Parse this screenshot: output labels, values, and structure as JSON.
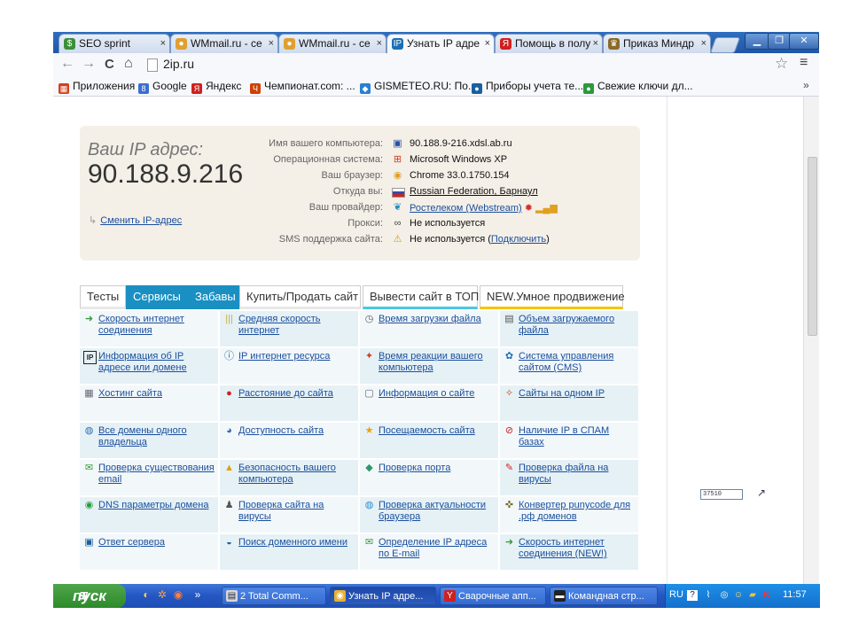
{
  "browser": {
    "tabs": [
      {
        "label": "SEO sprint",
        "icon": "dollar-icon",
        "color": "#3a8f3a"
      },
      {
        "label": "WMmail.ru - се",
        "icon": "coin-icon",
        "color": "#e0a030"
      },
      {
        "label": "WMmail.ru - се",
        "icon": "coin-icon",
        "color": "#e0a030"
      },
      {
        "label": "Узнать IP адре",
        "icon": "ip-icon",
        "color": "#1a6fb5"
      },
      {
        "label": "Помощь в полу",
        "icon": "yandex-icon",
        "color": "#d02020"
      },
      {
        "label": "Приказ Миндр",
        "icon": "emblem-icon",
        "color": "#8a6a2a"
      }
    ],
    "close_glyph": "×",
    "window_controls": {
      "minimize": "▁",
      "maximize": "❐",
      "close": "✕"
    },
    "nav": {
      "back": "←",
      "forward": "→",
      "reload": "C",
      "home": "⌂"
    },
    "url": "2ip.ru",
    "star": "☆",
    "menu": "≡",
    "bookmarks": [
      {
        "label": "Приложения",
        "color": "#d04020"
      },
      {
        "label": "Google",
        "color": "#3a6fd0"
      },
      {
        "label": "Яндекс",
        "color": "#d02020"
      },
      {
        "label": "Чемпионат.com: ...",
        "color": "#d04000"
      },
      {
        "label": "GISMETEO.RU: По...",
        "color": "#2a7fd0"
      },
      {
        "label": "Приборы учета те...",
        "color": "#1a5fa0"
      },
      {
        "label": "Свежие ключи дл...",
        "color": "#2a9a3a"
      }
    ],
    "bookmarks_more": "»"
  },
  "ip": {
    "label": "Ваш IP адрес:",
    "value": "90.188.9.216",
    "change_link": "Сменить IP-адрес",
    "rows": [
      {
        "key": "Имя вашего компьютера:",
        "value": "90.188.9-216.xdsl.ab.ru",
        "icon": "computer-icon",
        "link": false
      },
      {
        "key": "Операционная система:",
        "value": "Microsoft Windows XP",
        "icon": "windows-icon",
        "link": false
      },
      {
        "key": "Ваш браузер:",
        "value": "Chrome 33.0.1750.154",
        "icon": "chrome-icon",
        "link": false
      },
      {
        "key": "Откуда вы:",
        "value": "Russian Federation, Барнаул",
        "icon": "flag-icon",
        "link": true
      },
      {
        "key": "Ваш провайдер:",
        "value": "Ростелеком (Webstream)",
        "icon": "provider-icon",
        "link": true
      },
      {
        "key": "Прокси:",
        "value": "Не используется",
        "icon": "glasses-icon",
        "link": false
      },
      {
        "key": "SMS поддержка сайта:",
        "value": "Не используется (",
        "suffix_link": "Подключить",
        "suffix_end": ")",
        "icon": "warning-icon",
        "link": false
      }
    ]
  },
  "menu_tabs": [
    "Тесты",
    "Сервисы",
    "Забавы",
    "Купить/Продать сайт",
    "Вывести сайт в ТОП",
    "NEW.Умное продвижение"
  ],
  "services": [
    [
      "Скорость интернет соединения",
      "Средняя скорость интернет",
      "Время загрузки файла",
      "Объем загружаемого файла"
    ],
    [
      "Информация об IP адресе или домене",
      "IP интернет ресурса",
      "Время реакции вашего компьютера",
      "Система управления сайтом (CMS)"
    ],
    [
      "Хостинг сайта",
      "Расстояние до сайта",
      "Информация о сайте",
      "Сайты на одном IP"
    ],
    [
      "Все домены одного владельца",
      "Доступность сайта",
      "Посещаемость сайта",
      "Наличие IP в СПАМ базах"
    ],
    [
      "Проверка существования email",
      "Безопасность вашего компьютера",
      "Проверка порта",
      "Проверка файла на вирусы"
    ],
    [
      "DNS параметры домена",
      "Проверка сайта на вирусы",
      "Проверка актуальности браузера",
      "Конвертер punycode для .рф доменов"
    ],
    [
      "Ответ сервера",
      "Поиск доменного имени",
      "Определение IP адреса по E-mail",
      "Скорость интернет соединения (NEW!)"
    ]
  ],
  "service_icons": [
    [
      "speed-icon",
      "bars-icon",
      "clock-icon",
      "file-icon"
    ],
    [
      "ip-icon",
      "ip-circle-icon",
      "reaction-icon",
      "cms-icon"
    ],
    [
      "server-icon",
      "pin-icon",
      "info-icon",
      "network-icon"
    ],
    [
      "domains-icon",
      "availability-icon",
      "star-icon",
      "ban-icon"
    ],
    [
      "email-icon",
      "lock-icon",
      "port-icon",
      "virus-icon"
    ],
    [
      "dns-icon",
      "scan-icon",
      "browser-icon",
      "puny-icon"
    ],
    [
      "response-icon",
      "search-icon",
      "email-ip-icon",
      "speed-new-icon"
    ]
  ],
  "counter": "37510",
  "taskbar": {
    "start": "пуск",
    "quick_more": "»",
    "items": [
      {
        "label": "2 Total Comm...",
        "icon": "floppy-icon",
        "color": "#d8d8d8",
        "active": false
      },
      {
        "label": "Узнать IP адре...",
        "icon": "chrome-icon",
        "color": "#e8b030",
        "active": true
      },
      {
        "label": "Сварочные апп...",
        "icon": "yandex-icon",
        "color": "#d02020",
        "active": false
      },
      {
        "label": "Командная стр...",
        "icon": "console-icon",
        "color": "#222222",
        "active": false
      }
    ],
    "lang": "RU",
    "clock": "11:57"
  },
  "colors": {
    "accent": "#1a8fc2",
    "link": "#1a4f9c",
    "ipbox": "#f4efe7",
    "taskbar": "#2456c2",
    "start": "#2d8a2a"
  }
}
